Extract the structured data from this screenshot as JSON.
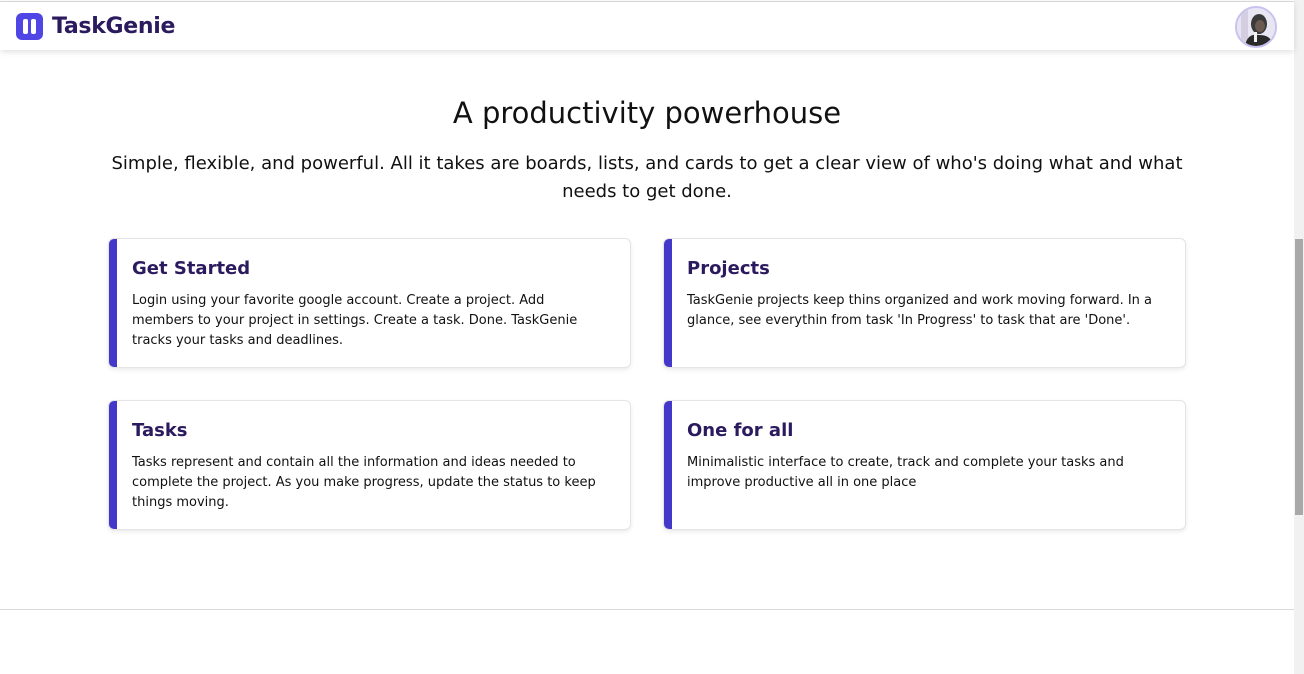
{
  "brand": {
    "name": "TaskGenie",
    "icon": "taskgenie-logo-icon",
    "color": "#4f46e5"
  },
  "user": {
    "avatar_icon": "user-avatar"
  },
  "hero": {
    "title": "A productivity powerhouse",
    "subtitle": "Simple, flexible, and powerful. All it takes are boards, lists, and cards to get a clear view of who's doing what and what needs to get done."
  },
  "features": [
    {
      "title": "Get Started",
      "text": "Login using your favorite google account. Create a project. Add members to your project in settings. Create a task. Done. TaskGenie tracks your tasks and deadlines."
    },
    {
      "title": "Projects",
      "text": "TaskGenie projects keep thins organized and work moving forward. In a glance, see everythin from task 'In Progress' to task that are 'Done'."
    },
    {
      "title": "Tasks",
      "text": "Tasks represent and contain all the information and ideas needed to complete the project. As you make progress, update the status to keep things moving."
    },
    {
      "title": "One for all",
      "text": "Minimalistic interface to create, track and complete your tasks and improve productive all in one place"
    }
  ],
  "colors": {
    "accent": "#4338ca",
    "heading": "#2b1a5e"
  }
}
